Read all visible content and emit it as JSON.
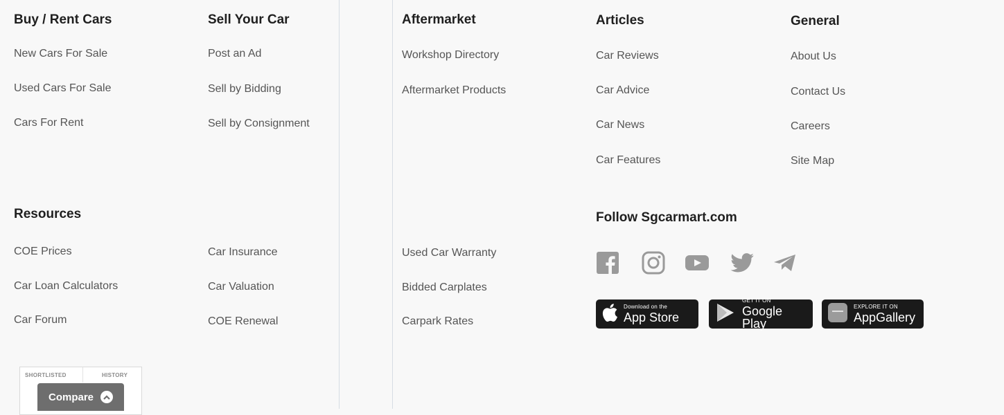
{
  "footer": {
    "buy_rent": {
      "title": "Buy / Rent Cars",
      "links": [
        "New Cars For Sale",
        "Used Cars For Sale",
        "Cars For Rent"
      ]
    },
    "sell": {
      "title": "Sell Your Car",
      "links": [
        "Post an Ad",
        "Sell by Bidding",
        "Sell by Consignment"
      ]
    },
    "aftermarket": {
      "title": "Aftermarket",
      "links": [
        "Workshop Directory",
        "Aftermarket Products"
      ]
    },
    "articles": {
      "title": "Articles",
      "links": [
        "Car Reviews",
        "Car Advice",
        "Car News",
        "Car Features"
      ]
    },
    "general": {
      "title": "General",
      "links": [
        "About Us",
        "Contact Us",
        "Careers",
        "Site Map"
      ]
    },
    "resources": {
      "title": "Resources",
      "col1": [
        "COE Prices",
        "Car Loan Calculators",
        "Car Forum"
      ],
      "col2": [
        "Car Insurance",
        "Car Valuation",
        "COE Renewal"
      ],
      "col3": [
        "Used Car Warranty",
        "Bidded Carplates",
        "Carpark Rates"
      ]
    },
    "follow": {
      "title": "Follow Sgcarmart.com",
      "icons": [
        "facebook-icon",
        "instagram-icon",
        "youtube-icon",
        "twitter-icon",
        "telegram-icon"
      ]
    },
    "stores": [
      {
        "small": "Download on the",
        "big": "App Store"
      },
      {
        "small": "GET IT ON",
        "big": "Google Play"
      },
      {
        "small": "EXPLORE IT ON",
        "big": "AppGallery"
      }
    ]
  },
  "compare_widget": {
    "tab_shortlisted": "SHORTLISTED",
    "tab_history": "HISTORY",
    "button_label": "Compare"
  },
  "colors": {
    "text": "#555555",
    "heading": "#1f1f1f",
    "icon": "#9a9a9a",
    "badge": "#1a1a1a"
  }
}
